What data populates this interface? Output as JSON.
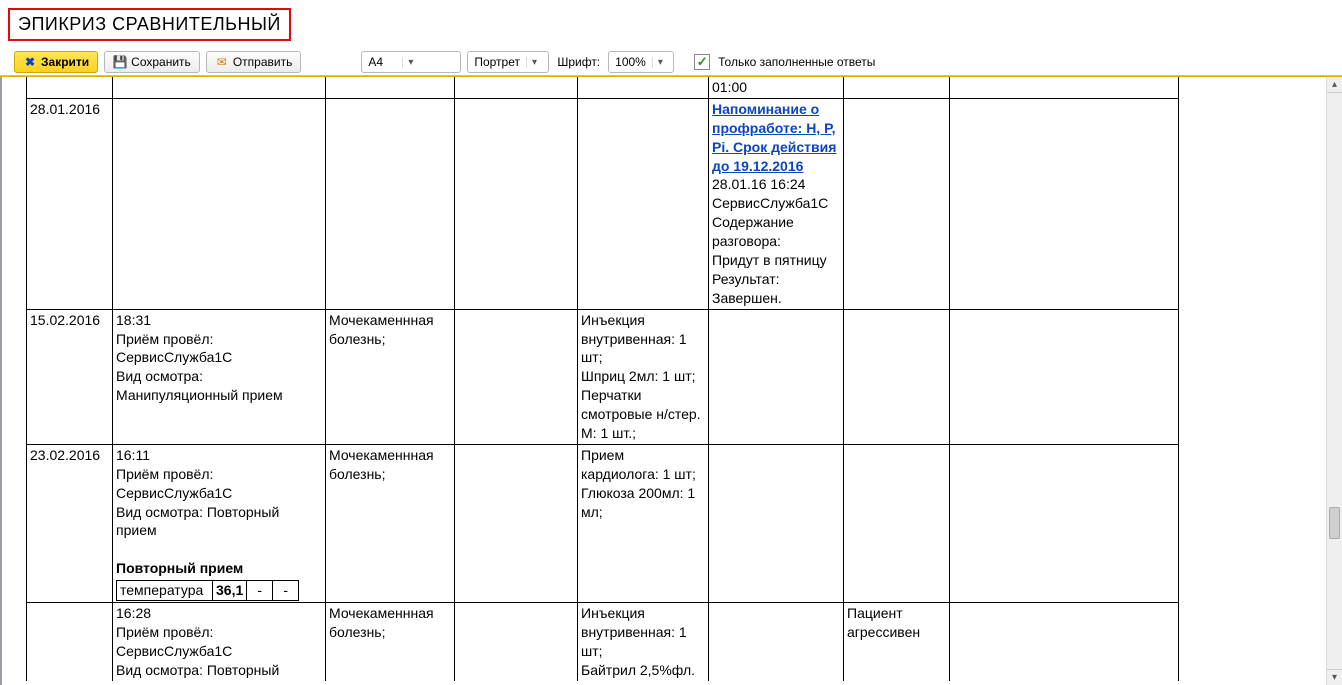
{
  "title": "ЭПИКРИЗ СРАВНИТЕЛЬНЫЙ",
  "toolbar": {
    "close_label": "Закрити",
    "save_label": "Сохранить",
    "send_label": "Отправить",
    "paper_size": "A4",
    "orientation": "Портрет",
    "font_label": "Шрифт:",
    "zoom": "100%",
    "filled_only_label": "Только заполненные ответы"
  },
  "cut_time": "01:00",
  "rows": [
    {
      "date": "28.01.2016",
      "c2": "",
      "c3": "",
      "c4": "",
      "c5": "",
      "c6_link": "Напоминание о профработе: H, P, Pi. Срок действия до 19.12.2016",
      "c6_text": "28.01.16 16:24\nСервисСлужба1С\nСодержание разговора:\nПридут в пятницу\nРезультат:\nЗавершен.",
      "c7": "",
      "c8": ""
    },
    {
      "date": "15.02.2016",
      "c2": "18:31\nПриём провёл:\nСервисСлужба1С\nВид осмотра:\nМанипуляционный прием",
      "c3": "Мочекаменнная болезнь;",
      "c4": "",
      "c5": "Инъекция внутривенная: 1 шт;\nШприц 2мл: 1 шт;\nПерчатки смотровые н/стер. M: 1 шт.;",
      "c6_link": "",
      "c6_text": "",
      "c7": "",
      "c8": ""
    },
    {
      "date": "23.02.2016",
      "c2": "16:11\nПриём провёл:\nСервисСлужба1С\nВид осмотра: Повторный прием",
      "c3": "Мочекаменнная болезнь;",
      "c4": "",
      "c5": "Прием кардиолога: 1 шт;\nГлюкоза 200мл: 1 мл;",
      "c6_link": "",
      "c6_text": "",
      "c7": "",
      "c8": "",
      "subheader": "Повторный прием",
      "nested": {
        "label": "температура",
        "value": "36,1",
        "dash1": "-",
        "dash2": "-"
      }
    },
    {
      "date": "",
      "c2": "16:28\nПриём провёл:\nСервисСлужба1С\nВид осмотра: Повторный",
      "c3": "Мочекаменнная болезнь;",
      "c4": "",
      "c5": "Инъекция внутривенная: 1 шт;\nБайтрил 2,5%фл.",
      "c6_link": "",
      "c6_text": "",
      "c7": "Пациент агрессивен",
      "c8": ""
    }
  ]
}
